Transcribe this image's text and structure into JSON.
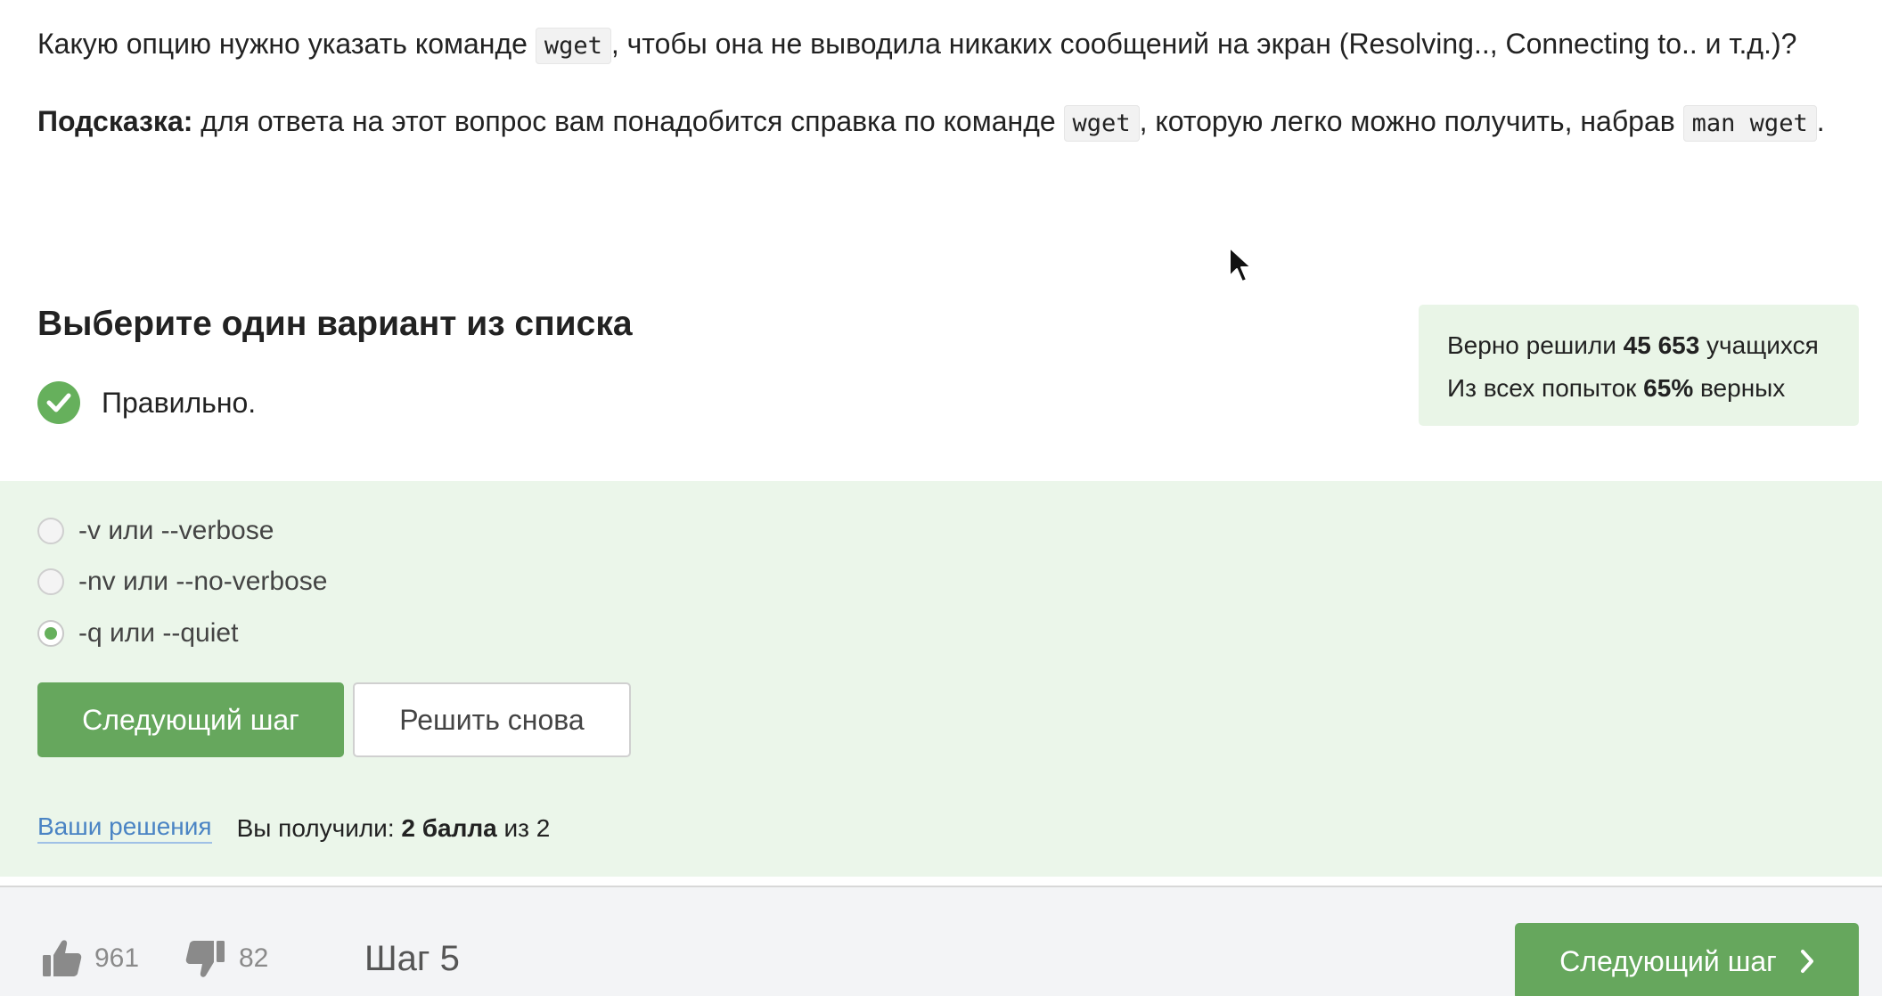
{
  "question": {
    "text_before": "Какую опцию нужно указать команде ",
    "code": "wget",
    "text_after": ", чтобы она не выводила никаких сообщений на экран (Resolving.., Connecting to.. и т.д.)?"
  },
  "hint": {
    "label": "Подсказка:",
    "text_before": " для ответа на этот вопрос вам понадобится справка по команде ",
    "code1": "wget",
    "text_middle": ", которую легко можно получить, набрав ",
    "code2": "man wget",
    "text_after": "."
  },
  "choose_title": "Выберите один вариант из списка",
  "status": {
    "text": "Правильно.",
    "icon": "check-circle-icon",
    "color": "#66b05c"
  },
  "stats": {
    "line1_prefix": "Верно решили ",
    "line1_value": "45 653",
    "line1_suffix": " учащихся",
    "line2_prefix": "Из всех попыток ",
    "line2_value": "65%",
    "line2_suffix": " верных"
  },
  "options": [
    {
      "label": "-v или --verbose",
      "checked": false
    },
    {
      "label": "-nv или --no-verbose",
      "checked": false
    },
    {
      "label": "-q или --quiet",
      "checked": true
    }
  ],
  "buttons": {
    "next_step": "Следующий шаг",
    "retry": "Решить снова"
  },
  "result": {
    "link": "Ваши решения",
    "prefix": "Вы получили: ",
    "points": "2 балла",
    "suffix": " из 2"
  },
  "footer": {
    "likes": "961",
    "dislikes": "82",
    "step": "Шаг 5",
    "next_button": "Следующий шаг"
  },
  "colors": {
    "accent_green": "#66a75d",
    "panel_bg": "#ebf6ea",
    "link_blue": "#4a84c4"
  }
}
